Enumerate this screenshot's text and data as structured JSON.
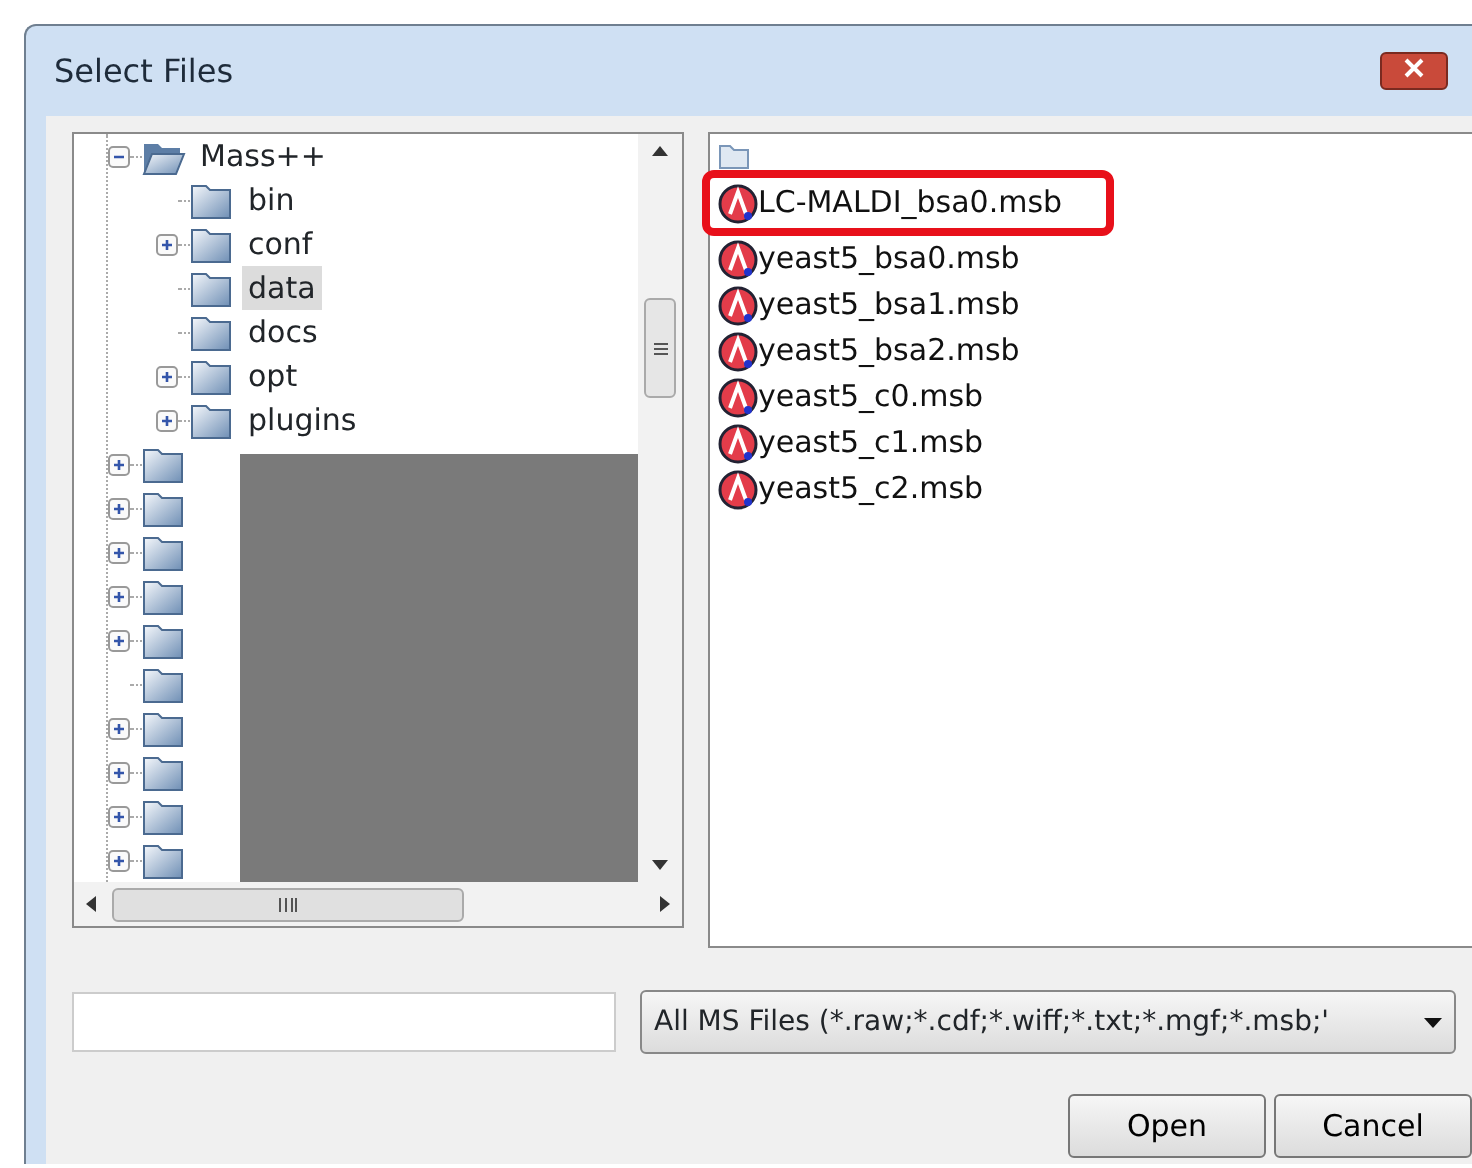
{
  "window": {
    "title": "Select Files"
  },
  "tree": {
    "redacted": true,
    "items": [
      {
        "label": "Mass++",
        "expanded": true,
        "has_children": true,
        "selected": false,
        "children": [
          {
            "label": "bin",
            "has_children": false,
            "expanded": false,
            "selected": false
          },
          {
            "label": "conf",
            "has_children": true,
            "expanded": false,
            "selected": false
          },
          {
            "label": "data",
            "has_children": false,
            "expanded": false,
            "selected": true
          },
          {
            "label": "docs",
            "has_children": false,
            "expanded": false,
            "selected": false
          },
          {
            "label": "opt",
            "has_children": true,
            "expanded": false,
            "selected": false
          },
          {
            "label": "plugins",
            "has_children": true,
            "expanded": false,
            "selected": false
          }
        ]
      },
      {
        "has_children": true,
        "expanded": false,
        "selected": false
      },
      {
        "has_children": true,
        "expanded": false,
        "selected": false
      },
      {
        "has_children": true,
        "expanded": false,
        "selected": false
      },
      {
        "has_children": true,
        "expanded": false,
        "selected": false
      },
      {
        "has_children": true,
        "expanded": false,
        "selected": false
      },
      {
        "has_children": false,
        "expanded": false,
        "selected": false
      },
      {
        "has_children": true,
        "expanded": false,
        "selected": false
      },
      {
        "has_children": true,
        "expanded": false,
        "selected": false
      },
      {
        "has_children": true,
        "expanded": false,
        "selected": false
      },
      {
        "has_children": true,
        "expanded": false,
        "selected": false
      }
    ]
  },
  "files": [
    {
      "kind": "folder",
      "highlighted": false
    },
    {
      "kind": "file",
      "label": "LC-MALDI_bsa0.msb",
      "highlighted": true
    },
    {
      "kind": "file",
      "label": "yeast5_bsa0.msb",
      "highlighted": false
    },
    {
      "kind": "file",
      "label": "yeast5_bsa1.msb",
      "highlighted": false
    },
    {
      "kind": "file",
      "label": "yeast5_bsa2.msb",
      "highlighted": false
    },
    {
      "kind": "file",
      "label": "yeast5_c0.msb",
      "highlighted": false
    },
    {
      "kind": "file",
      "label": "yeast5_c1.msb",
      "highlighted": false
    },
    {
      "kind": "file",
      "label": "yeast5_c2.msb",
      "highlighted": false
    }
  ],
  "file_type": "All MS Files (*.raw;*.cdf;*.wiff;*.txt;*.mgf;*.msb;'",
  "buttons": [
    "Open",
    "Cancel"
  ]
}
